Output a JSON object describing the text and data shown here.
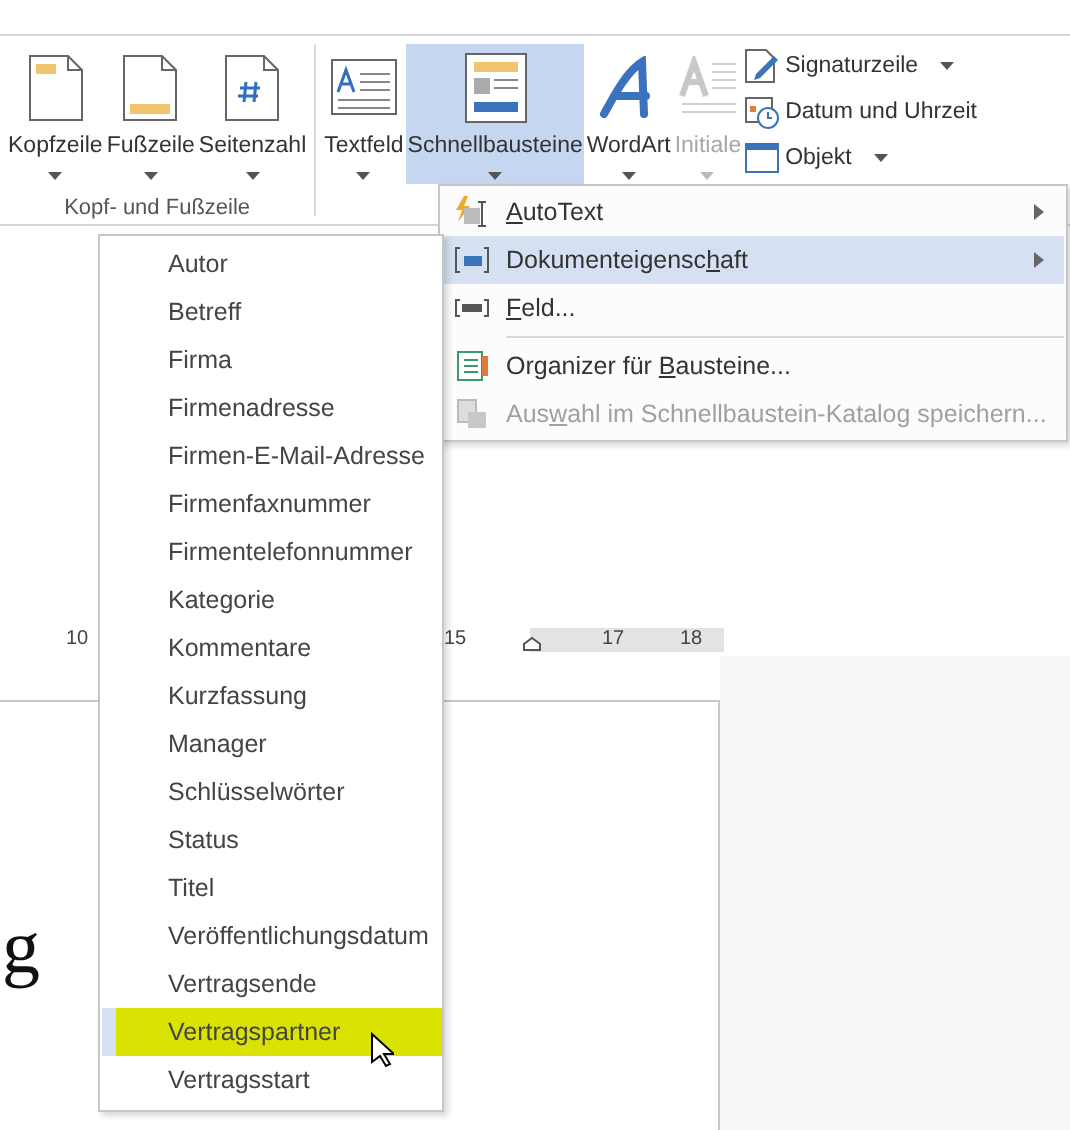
{
  "ribbon": {
    "groups": [
      {
        "label": "Kopf- und Fußzeile",
        "buttons": [
          {
            "label": "Kopfzeile",
            "kind": "header",
            "selected": false,
            "disabled": false
          },
          {
            "label": "Fußzeile",
            "kind": "footer",
            "selected": false,
            "disabled": false
          },
          {
            "label": "Seitenzahl",
            "kind": "pagenumber",
            "selected": false,
            "disabled": false
          }
        ]
      },
      {
        "buttons": [
          {
            "label": "Textfeld",
            "kind": "textbox",
            "selected": false,
            "disabled": false
          },
          {
            "label": "Schnellbausteine",
            "kind": "quickparts",
            "selected": true,
            "disabled": false
          },
          {
            "label": "WordArt",
            "kind": "wordart",
            "selected": false,
            "disabled": false
          },
          {
            "label": "Initiale",
            "kind": "dropcap",
            "selected": false,
            "disabled": true
          }
        ],
        "small_buttons": [
          {
            "label": "Signaturzeile",
            "kind": "signature",
            "dropdown": true
          },
          {
            "label": "Datum und Uhrzeit",
            "kind": "datetime",
            "dropdown": false
          },
          {
            "label": "Objekt",
            "kind": "object",
            "dropdown": true
          }
        ]
      }
    ]
  },
  "quick_parts_menu": {
    "items": [
      {
        "key": "A",
        "post": "utoText",
        "kind": "autotext",
        "submenu": true,
        "selected": false,
        "disabled": false
      },
      {
        "pre": "Dokumenteigensc",
        "key": "h",
        "post": "aft",
        "kind": "docprop",
        "submenu": true,
        "selected": true,
        "disabled": false
      },
      {
        "key": "F",
        "post": "eld...",
        "kind": "field",
        "submenu": false,
        "selected": false,
        "disabled": false
      },
      {
        "pre": "Organizer für ",
        "key": "B",
        "post": "austeine...",
        "kind": "organizer",
        "submenu": false,
        "selected": false,
        "disabled": false
      },
      {
        "pre": "Aus",
        "key": "w",
        "post": "ahl im Schnellbaustein-Katalog speichern...",
        "kind": "save",
        "submenu": false,
        "selected": false,
        "disabled": true
      }
    ]
  },
  "property_menu": {
    "items": [
      {
        "label": "Autor",
        "selected": false
      },
      {
        "label": "Betreff",
        "selected": false
      },
      {
        "label": "Firma",
        "selected": false
      },
      {
        "label": "Firmenadresse",
        "selected": false
      },
      {
        "label": "Firmen-E-Mail-Adresse",
        "selected": false
      },
      {
        "label": "Firmenfaxnummer",
        "selected": false
      },
      {
        "label": "Firmentelefonnummer",
        "selected": false
      },
      {
        "label": "Kategorie",
        "selected": false
      },
      {
        "label": "Kommentare",
        "selected": false
      },
      {
        "label": "Kurzfassung",
        "selected": false
      },
      {
        "label": "Manager",
        "selected": false
      },
      {
        "label": "Schlüsselwörter",
        "selected": false
      },
      {
        "label": "Status",
        "selected": false
      },
      {
        "label": "Titel",
        "selected": false
      },
      {
        "label": "Veröffentlichungsdatum",
        "selected": false
      },
      {
        "label": "Vertragsende",
        "selected": false
      },
      {
        "label": "Vertragspartner",
        "selected": true
      },
      {
        "label": "Vertragsstart",
        "selected": false
      }
    ]
  },
  "ruler": {
    "marks": [
      "10",
      "15",
      "17",
      "18"
    ]
  },
  "document": {
    "text": "g"
  }
}
